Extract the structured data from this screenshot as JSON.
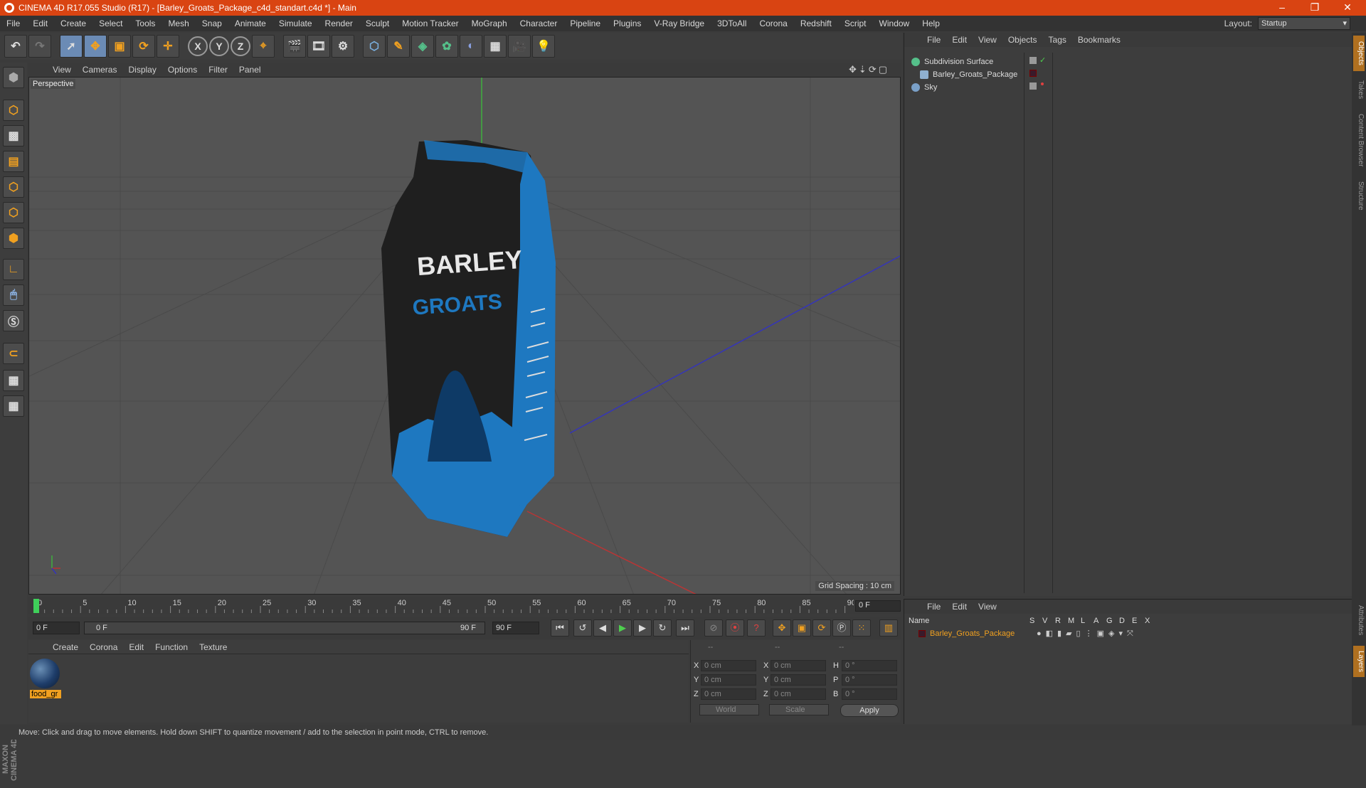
{
  "app": {
    "title": "CINEMA 4D R17.055 Studio (R17) - [Barley_Groats_Package_c4d_standart.c4d *] - Main"
  },
  "menu": [
    "File",
    "Edit",
    "Create",
    "Select",
    "Tools",
    "Mesh",
    "Snap",
    "Animate",
    "Simulate",
    "Render",
    "Sculpt",
    "Motion Tracker",
    "MoGraph",
    "Character",
    "Pipeline",
    "Plugins",
    "V-Ray Bridge",
    "3DToAll",
    "Corona",
    "Redshift",
    "Script",
    "Window",
    "Help"
  ],
  "layout": {
    "label": "Layout:",
    "value": "Startup"
  },
  "toolbar": {
    "x": "X",
    "y": "Y",
    "z": "Z"
  },
  "viewport": {
    "menu": [
      "View",
      "Cameras",
      "Display",
      "Options",
      "Filter",
      "Panel"
    ],
    "label": "Perspective",
    "grid_spacing": "Grid Spacing : 10 cm",
    "package_text_1": "BARLEY",
    "package_text_2": "GROATS"
  },
  "timeline": {
    "ticks": [
      "0",
      "5",
      "10",
      "15",
      "20",
      "25",
      "30",
      "35",
      "40",
      "45",
      "50",
      "55",
      "60",
      "65",
      "70",
      "75",
      "80",
      "85",
      "90"
    ],
    "current": "0 F"
  },
  "playbar": {
    "start": "0 F",
    "range_start": "0 F",
    "range_end": "90 F",
    "end": "90 F"
  },
  "material_manager": {
    "menu": [
      "Create",
      "Corona",
      "Edit",
      "Function",
      "Texture"
    ],
    "material_name": "food_gr"
  },
  "coordinates": {
    "headers": [
      "--",
      "--",
      "--"
    ],
    "rows": [
      {
        "a_label": "X",
        "a_val": "0 cm",
        "b_label": "X",
        "b_val": "0 cm",
        "c_label": "H",
        "c_val": "0 °"
      },
      {
        "a_label": "Y",
        "a_val": "0 cm",
        "b_label": "Y",
        "b_val": "0 cm",
        "c_label": "P",
        "c_val": "0 °"
      },
      {
        "a_label": "Z",
        "a_val": "0 cm",
        "b_label": "Z",
        "b_val": "0 cm",
        "c_label": "B",
        "c_val": "0 °"
      }
    ],
    "mode": "World",
    "transform": "Scale",
    "apply": "Apply"
  },
  "status": "Move: Click and drag to move elements. Hold down SHIFT to quantize movement / add to the selection in point mode, CTRL to remove.",
  "objects": {
    "menu": [
      "File",
      "Edit",
      "View",
      "Objects",
      "Tags",
      "Bookmarks"
    ],
    "items": [
      {
        "name": "Subdivision Surface",
        "icon_color": "#55c08a"
      },
      {
        "name": "Barley_Groats_Package",
        "icon_color": "#8fb0d0"
      },
      {
        "name": "Sky",
        "icon_color": "#7aa0c8"
      }
    ]
  },
  "layers": {
    "menu": [
      "File",
      "Edit",
      "View"
    ],
    "headers": [
      "Name",
      "S",
      "V",
      "R",
      "M",
      "L",
      "A",
      "G",
      "D",
      "E",
      "X"
    ],
    "row": "Barley_Groats_Package"
  },
  "right_tabs": [
    "Objects",
    "Takes",
    "Content Browser",
    "Structure",
    "Attributes",
    "Layers"
  ],
  "maxon": "MAXON CINEMA 4D"
}
